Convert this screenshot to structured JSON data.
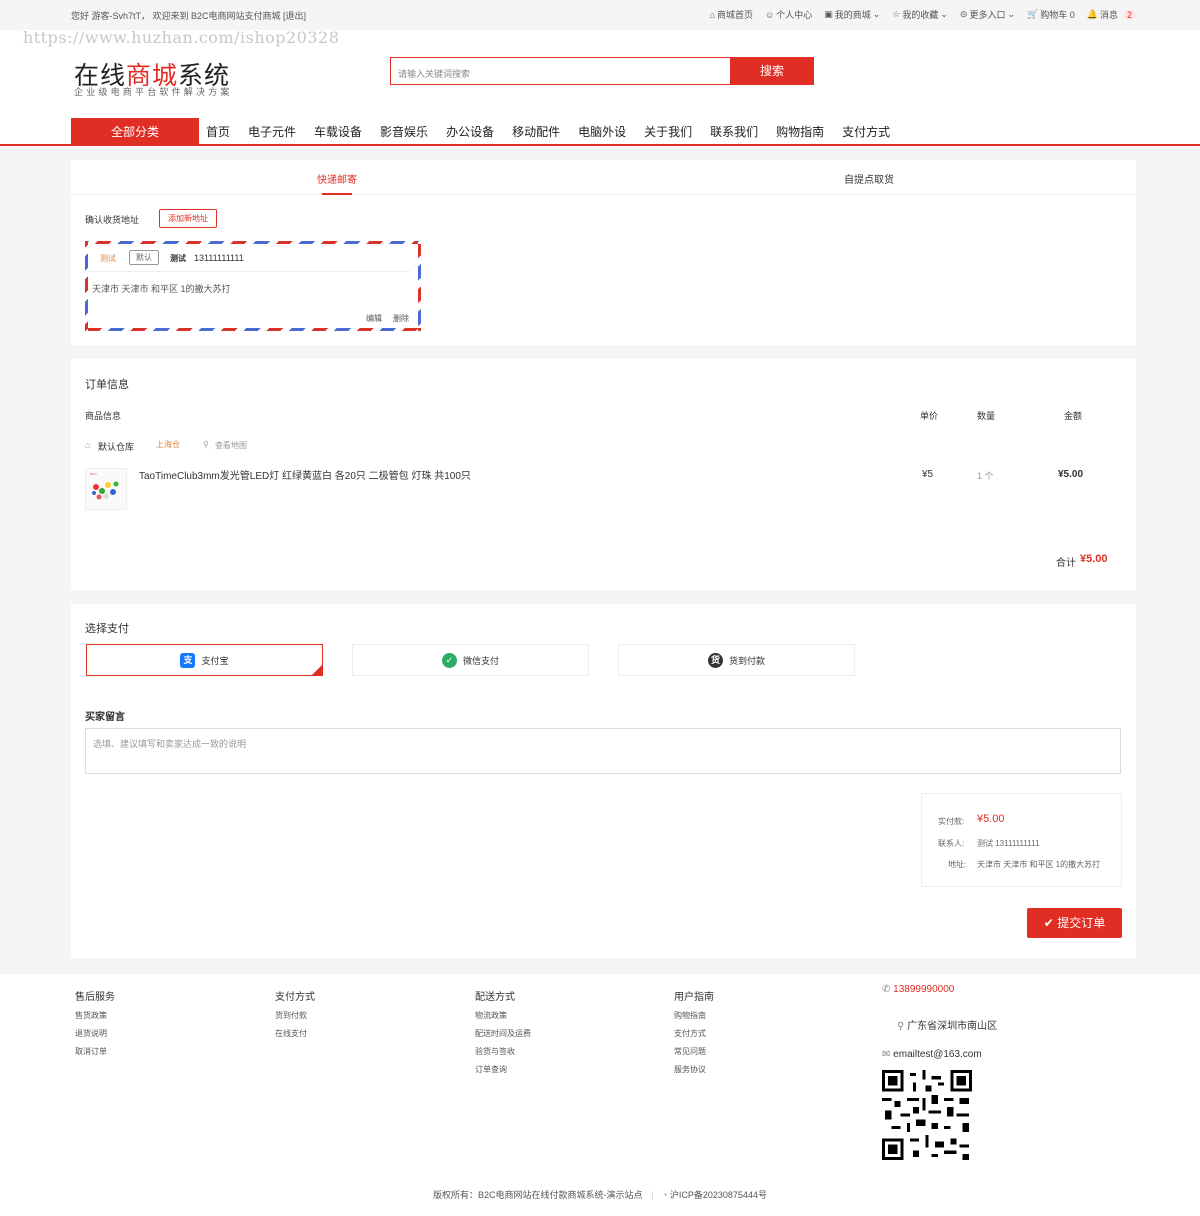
{
  "topbar": {
    "greeting": "您好 游客-Svh7tT， 欢迎来到 B2C电商网站支付商城 [退出]",
    "nav": [
      {
        "label": "商城首页",
        "icon": "home-icon"
      },
      {
        "label": "个人中心",
        "icon": "user-icon"
      },
      {
        "label": "我的商城",
        "icon": "shop-icon",
        "dropdown": true
      },
      {
        "label": "我的收藏",
        "icon": "star-icon",
        "dropdown": true
      },
      {
        "label": "更多入口",
        "icon": "more-icon",
        "dropdown": true
      },
      {
        "label": "购物车 0",
        "icon": "cart-icon"
      },
      {
        "label": "消息",
        "icon": "bell-icon",
        "badge": "2"
      }
    ]
  },
  "watermark": "https://www.huzhan.com/ishop20328",
  "header": {
    "logo_part1": "在线",
    "logo_part2": "商城",
    "logo_part3": "系统",
    "logo_sub": "企业级电商平台软件解决方案",
    "search_placeholder": "请输入关键词搜索",
    "search_button": "搜索",
    "all_categories": "全部分类",
    "nav": [
      "首页",
      "电子元件",
      "车载设备",
      "影音娱乐",
      "办公设备",
      "移动配件",
      "电脑外设",
      "关于我们",
      "联系我们",
      "购物指南",
      "支付方式"
    ]
  },
  "delivery": {
    "tabs": [
      "快递邮寄",
      "自提点取货"
    ],
    "confirm_label": "确认收货地址",
    "add_address": "添加新地址",
    "address": {
      "tag": "测试",
      "default": "默认",
      "name": "测试",
      "phone": "13111111111",
      "detail": "天津市 天津市 和平区 1的撒大苏打",
      "edit": "编辑",
      "delete": "删除"
    }
  },
  "order": {
    "title": "订单信息",
    "headers": {
      "product": "商品信息",
      "price": "单价",
      "qty": "数量",
      "amount": "金额"
    },
    "warehouse": "默认仓库",
    "warehouse_tag": "上海仓",
    "view_map": "查看地图",
    "item": {
      "name": "TaoTimeClub3mm发光管LED灯 红绿黄蓝白 各20只 二极管包 灯珠 共100只",
      "price": "¥5",
      "qty": "1 个",
      "amount": "¥5.00"
    },
    "total_label": "合计",
    "total_value": "¥5.00"
  },
  "payment": {
    "title": "选择支付",
    "options": [
      {
        "label": "支付宝",
        "icon": "alipay-icon",
        "color": "#1677ff",
        "glyph": "支"
      },
      {
        "label": "微信支付",
        "icon": "wechat-icon",
        "color": "#2aae67",
        "glyph": "✓"
      },
      {
        "label": "货到付款",
        "icon": "cod-icon",
        "color": "#333333",
        "glyph": "货"
      }
    ],
    "message_label": "买家留言",
    "message_placeholder": "选填、建议填写和卖家达成一致的说明",
    "summary": {
      "paid_label": "实付款:",
      "paid_value": "¥5.00",
      "contact_label": "联系人:",
      "contact_value": "测试 13111111111",
      "address_label": "地址:",
      "address_value": "天津市 天津市 和平区 1的撒大苏打"
    },
    "submit": "提交订单"
  },
  "footer": {
    "columns": [
      {
        "title": "售后服务",
        "links": [
          "售货政策",
          "退货说明",
          "取消订单"
        ]
      },
      {
        "title": "支付方式",
        "links": [
          "货到付款",
          "在线支付"
        ]
      },
      {
        "title": "配送方式",
        "links": [
          "物流政策",
          "配送时间及运费",
          "验货与签收",
          "订单查询"
        ]
      },
      {
        "title": "用户指南",
        "links": [
          "购物指南",
          "支付方式",
          "常见问题",
          "服务协议"
        ]
      }
    ],
    "phone": "13899990000",
    "location": "广东省深圳市南山区",
    "email": "emailtest@163.com",
    "copyright": "版权所有：B2C电商网站在线付款商城系统-演示站点",
    "icp": "沪ICP备2023087544​4号"
  },
  "colors": {
    "accent": "#e02e24"
  }
}
